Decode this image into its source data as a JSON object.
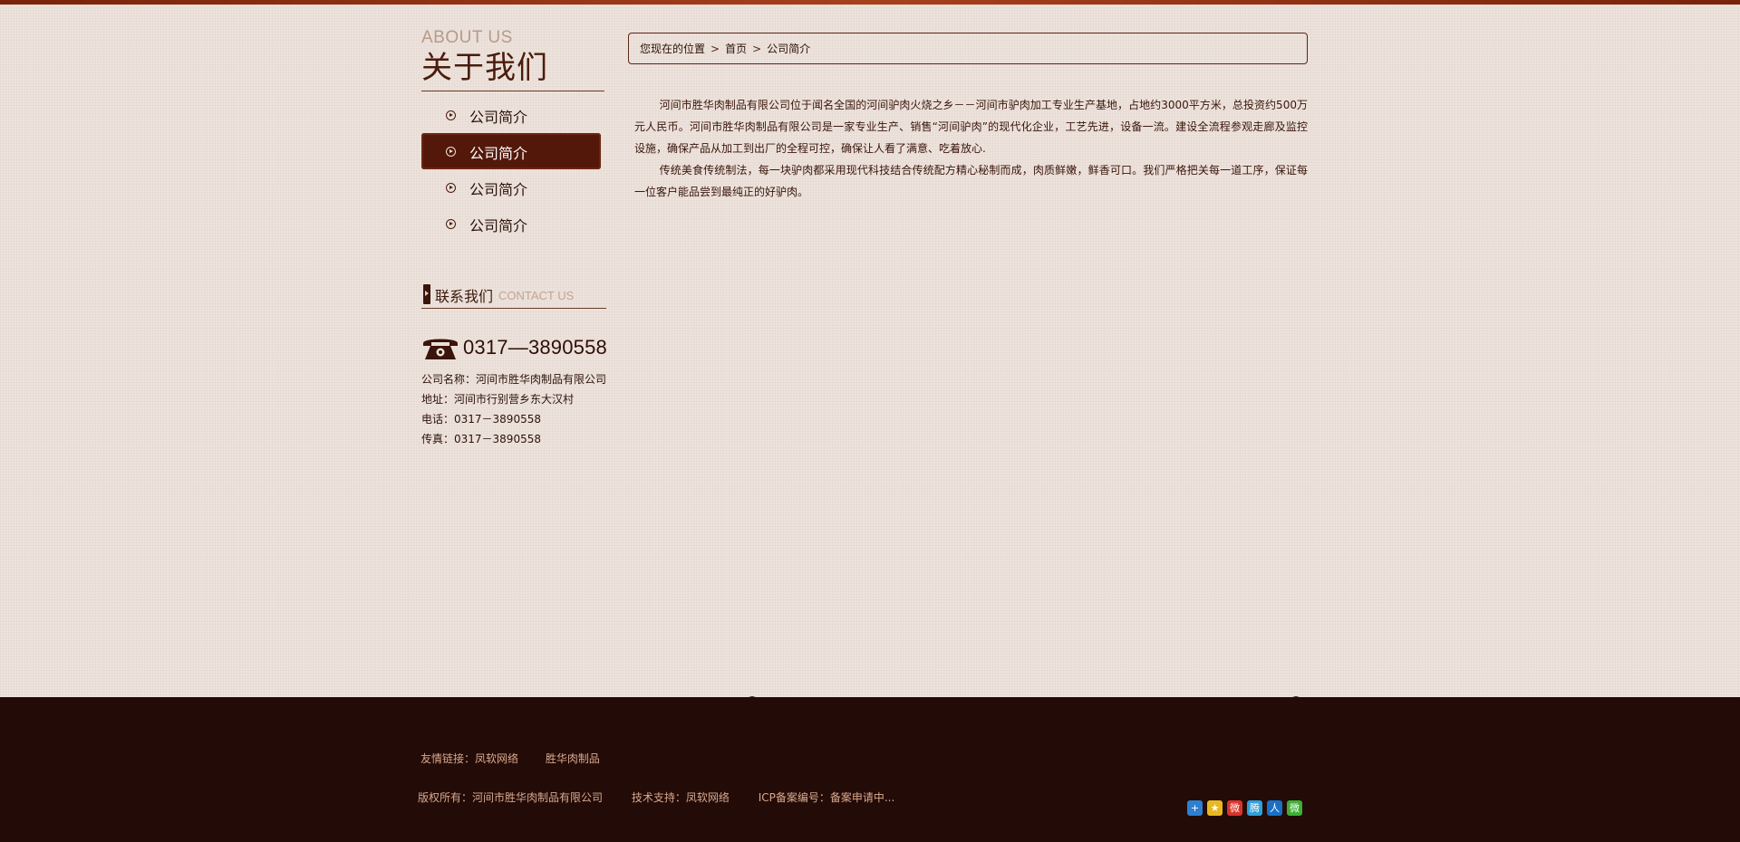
{
  "colors": {
    "accent": "#54180b",
    "footer_bg": "#230b07",
    "page_bg": "#ede3dc",
    "footer_text": "#d9a98e"
  },
  "sidebar": {
    "title_en": "ABOUT US",
    "title_cn": "关于我们",
    "items": [
      {
        "label": "公司简介",
        "active": false
      },
      {
        "label": "公司简介",
        "active": true
      },
      {
        "label": "公司简介",
        "active": false
      },
      {
        "label": "公司简介",
        "active": false
      }
    ],
    "contact": {
      "title_cn": "联系我们",
      "title_en": "CONTACT US",
      "phone_display": "0317—3890558",
      "lines": [
        "公司名称：河间市胜华肉制品有限公司",
        "地址：河间市行别营乡东大汉村",
        "电话：0317－3890558",
        "传真：0317－3890558"
      ]
    }
  },
  "breadcrumb": {
    "prefix": "您现在的位置",
    "home": "首页",
    "current": "公司简介"
  },
  "content": {
    "paragraphs": [
      "河间市胜华肉制品有限公司位于闻名全国的河间驴肉火烧之乡－－河间市驴肉加工专业生产基地，占地约3000平方米，总投资约500万元人民币。河间市胜华肉制品有限公司是一家专业生产、销售“河间驴肉”的现代化企业，工艺先进，设备一流。建设全流程参观走廊及监控设施，确保产品从加工到出厂的全程可控，确保让人看了满意、吃着放心.",
      "传统美食传统制法，每一块驴肉都采用现代科技结合传统配方精心秘制而成，肉质鲜嫩，鲜香可口。我们严格把关每一道工序，保证每一位客户能品尝到最纯正的好驴肉。"
    ]
  },
  "footer": {
    "friend_label": "友情链接：",
    "friend_links": [
      "凤软网络",
      "胜华肉制品"
    ],
    "copyright": "版权所有：河间市胜华肉制品有限公司",
    "support": "技术支持：凤软网络",
    "icp": "ICP备案编号：备案申请中...",
    "share_icons": [
      {
        "name": "share-more-icon",
        "color": "#2f7fd0",
        "glyph": "+"
      },
      {
        "name": "qzone-icon",
        "color": "#e8b822",
        "glyph": "★"
      },
      {
        "name": "weibo-icon",
        "color": "#d8342a",
        "glyph": "微"
      },
      {
        "name": "tencent-weibo-icon",
        "color": "#2fa0d8",
        "glyph": "腾"
      },
      {
        "name": "renren-icon",
        "color": "#1a6fc4",
        "glyph": "人"
      },
      {
        "name": "wechat-icon",
        "color": "#3cb034",
        "glyph": "微"
      }
    ]
  }
}
